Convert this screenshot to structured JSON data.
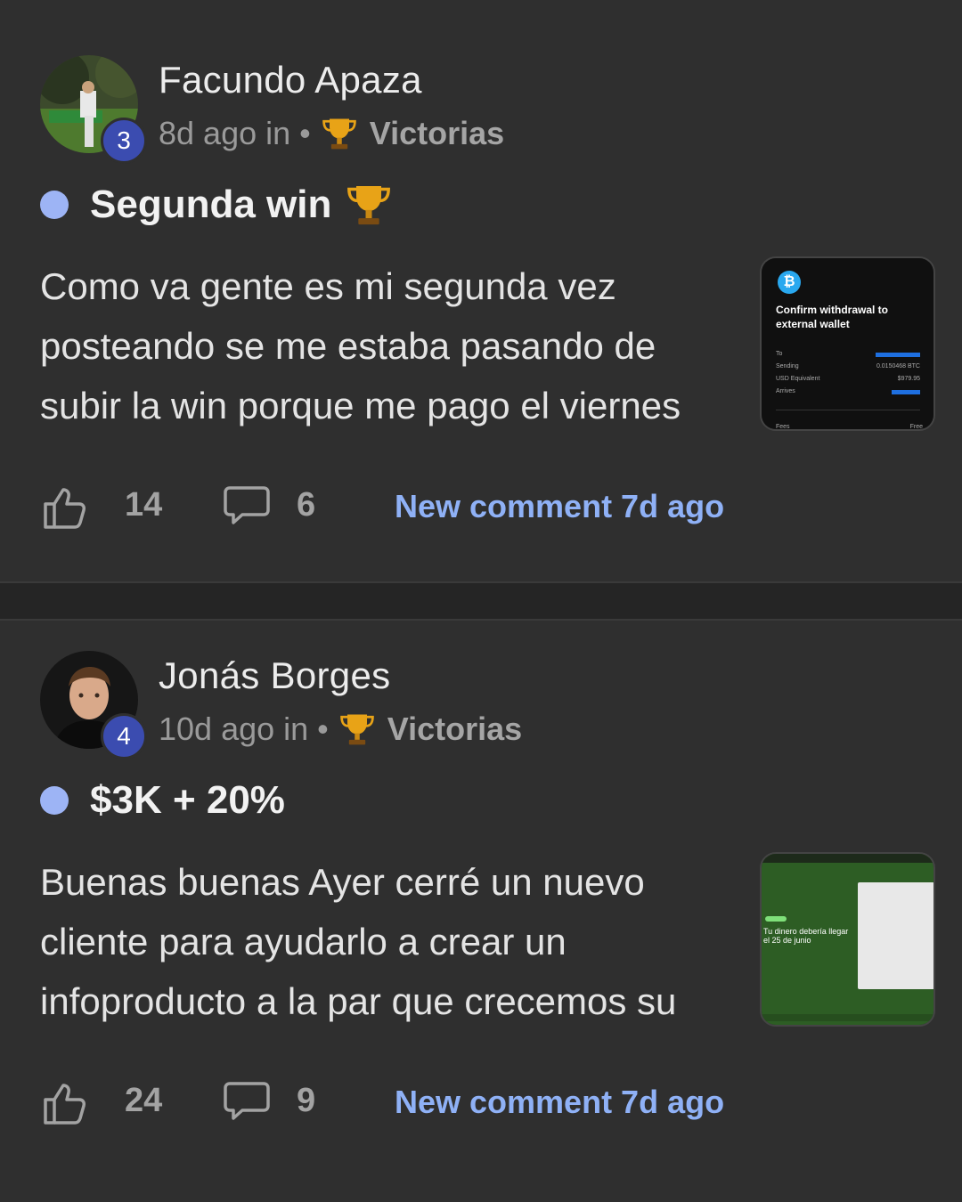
{
  "posts": [
    {
      "author": "Facundo Apaza",
      "level": "3",
      "time": "8d ago in",
      "separator": "•",
      "category": "Victorias",
      "title": "Segunda win",
      "body_lines": [
        "Como va gente es mi segunda vez",
        "posteando se me estaba pasando de",
        "subir la win porque me pago el viernes"
      ],
      "likes": "14",
      "comments": "6",
      "new_comment": "New comment 7d ago",
      "thumbnail": {
        "heading": "Confirm withdrawal to external wallet",
        "rows": [
          {
            "label": "To",
            "value": ""
          },
          {
            "label": "Sending",
            "value": "0.0150468 BTC"
          },
          {
            "label": "USD Equivalent",
            "value": "$979.95"
          },
          {
            "label": "Arrives",
            "value": ""
          }
        ],
        "footer_left": "Fees",
        "footer_right": "Free"
      }
    },
    {
      "author": "Jonás Borges",
      "level": "4",
      "time": "10d ago in",
      "separator": "•",
      "category": "Victorias",
      "title": "$3K + 20%",
      "body_lines": [
        "Buenas buenas Ayer cerré un nuevo",
        "cliente para ayudarlo a crear un",
        "infoproducto a la par que crecemos su"
      ],
      "likes": "24",
      "comments": "9",
      "new_comment": "New comment 7d ago",
      "thumbnail": {
        "caption": "Tu dinero debería llegar el 25 de junio"
      }
    }
  ],
  "colors": {
    "background": "#2f2f2f",
    "accent_link": "#8fb1f6",
    "unread_dot": "#9db4f5",
    "level_badge": "#3b4cb0"
  }
}
